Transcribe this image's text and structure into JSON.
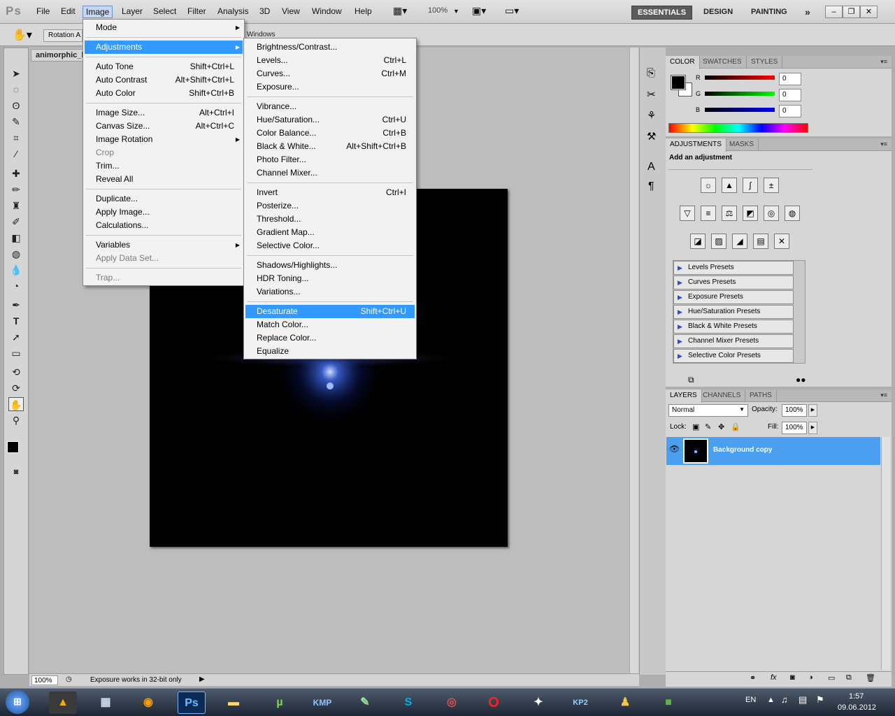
{
  "app": {
    "logo": "Ps"
  },
  "menubar": {
    "items": [
      "File",
      "Edit",
      "Image",
      "Layer",
      "Select",
      "Filter",
      "Analysis",
      "3D",
      "View",
      "Window",
      "Help"
    ],
    "zoom": "100%",
    "workspaces": [
      "ESSENTIALS",
      "DESIGN",
      "PAINTING"
    ],
    "more": "»"
  },
  "options": {
    "label": "Rotation A",
    "windows_label": "Windows"
  },
  "document": {
    "tab_title": "animorphic_l"
  },
  "image_menu": [
    {
      "label": "Mode",
      "submenu": true
    },
    {
      "sep": true
    },
    {
      "label": "Adjustments",
      "submenu": true,
      "highlighted": true
    },
    {
      "sep": true
    },
    {
      "label": "Auto Tone",
      "shortcut": "Shift+Ctrl+L"
    },
    {
      "label": "Auto Contrast",
      "shortcut": "Alt+Shift+Ctrl+L"
    },
    {
      "label": "Auto Color",
      "shortcut": "Shift+Ctrl+B"
    },
    {
      "sep": true
    },
    {
      "label": "Image Size...",
      "shortcut": "Alt+Ctrl+I"
    },
    {
      "label": "Canvas Size...",
      "shortcut": "Alt+Ctrl+C"
    },
    {
      "label": "Image Rotation",
      "submenu": true
    },
    {
      "label": "Crop",
      "disabled": true
    },
    {
      "label": "Trim..."
    },
    {
      "label": "Reveal All"
    },
    {
      "sep": true
    },
    {
      "label": "Duplicate..."
    },
    {
      "label": "Apply Image..."
    },
    {
      "label": "Calculations..."
    },
    {
      "sep": true
    },
    {
      "label": "Variables",
      "submenu": true
    },
    {
      "label": "Apply Data Set...",
      "disabled": true
    },
    {
      "sep": true
    },
    {
      "label": "Trap...",
      "disabled": true
    }
  ],
  "adjustments_menu": [
    {
      "label": "Brightness/Contrast..."
    },
    {
      "label": "Levels...",
      "shortcut": "Ctrl+L"
    },
    {
      "label": "Curves...",
      "shortcut": "Ctrl+M"
    },
    {
      "label": "Exposure..."
    },
    {
      "sep": true
    },
    {
      "label": "Vibrance..."
    },
    {
      "label": "Hue/Saturation...",
      "shortcut": "Ctrl+U"
    },
    {
      "label": "Color Balance...",
      "shortcut": "Ctrl+B"
    },
    {
      "label": "Black & White...",
      "shortcut": "Alt+Shift+Ctrl+B"
    },
    {
      "label": "Photo Filter..."
    },
    {
      "label": "Channel Mixer..."
    },
    {
      "sep": true
    },
    {
      "label": "Invert",
      "shortcut": "Ctrl+I"
    },
    {
      "label": "Posterize..."
    },
    {
      "label": "Threshold..."
    },
    {
      "label": "Gradient Map..."
    },
    {
      "label": "Selective Color..."
    },
    {
      "sep": true
    },
    {
      "label": "Shadows/Highlights..."
    },
    {
      "label": "HDR Toning..."
    },
    {
      "label": "Variations..."
    },
    {
      "sep": true
    },
    {
      "label": "Desaturate",
      "shortcut": "Shift+Ctrl+U",
      "highlighted": true
    },
    {
      "label": "Match Color..."
    },
    {
      "label": "Replace Color..."
    },
    {
      "label": "Equalize"
    }
  ],
  "color_panel": {
    "tabs": [
      "COLOR",
      "SWATCHES",
      "STYLES"
    ],
    "r_label": "R",
    "g_label": "G",
    "b_label": "B",
    "r": "0",
    "g": "0",
    "b": "0"
  },
  "adjustments_panel": {
    "tabs": [
      "ADJUSTMENTS",
      "MASKS"
    ],
    "heading": "Add an adjustment",
    "presets": [
      "Levels Presets",
      "Curves Presets",
      "Exposure Presets",
      "Hue/Saturation Presets",
      "Black & White Presets",
      "Channel Mixer Presets",
      "Selective Color Presets"
    ]
  },
  "layers_panel": {
    "tabs": [
      "LAYERS",
      "CHANNELS",
      "PATHS"
    ],
    "blend_mode": "Normal",
    "opacity_label": "Opacity:",
    "opacity": "100%",
    "lock_label": "Lock:",
    "fill_label": "Fill:",
    "fill": "100%",
    "layer_name": "Background copy"
  },
  "status": {
    "zoom": "100%",
    "info": "Exposure works in 32-bit only"
  },
  "taskbar": {
    "lang": "EN",
    "time": "1:57",
    "date": "09.06.2012"
  },
  "colors": {
    "highlight": "#3399ff",
    "layer_selected": "#4a9ff0"
  }
}
